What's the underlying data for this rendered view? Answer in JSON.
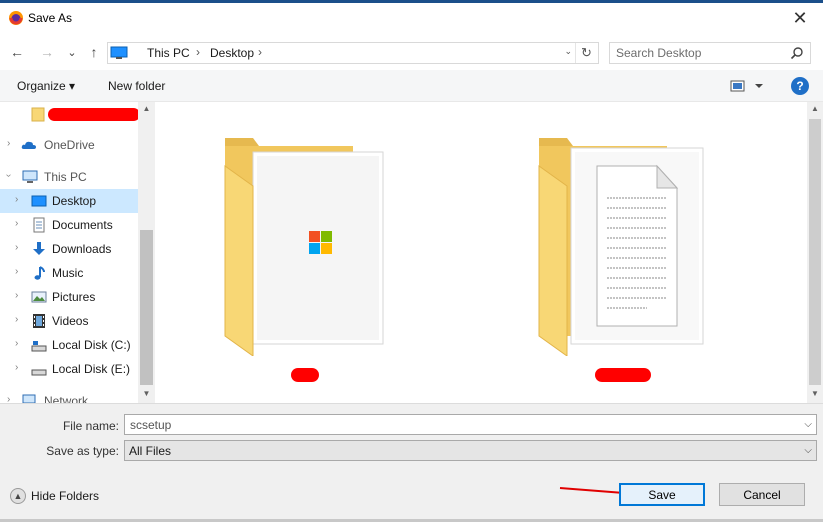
{
  "window": {
    "title": "Save As",
    "close_glyph": "✕",
    "app_icon": "firefox-icon"
  },
  "navigation": {
    "back_glyph": "←",
    "forward_glyph": "→",
    "recent_glyph": "⌄",
    "up_glyph": "↑",
    "breadcrumbs": [
      "This PC",
      "Desktop"
    ],
    "breadcrumb_sep": "›",
    "dropdown_glyph": "⌄",
    "refresh_glyph": "↻"
  },
  "search": {
    "placeholder": "Search Desktop"
  },
  "toolbar": {
    "organize": "Organize ▾",
    "new_folder": "New folder",
    "help": "?"
  },
  "sidebar": {
    "items": [
      {
        "label": "",
        "icon": "folder-icon",
        "redacted": true
      },
      {
        "label": "OneDrive",
        "icon": "onedrive-icon"
      },
      {
        "label": "This PC",
        "icon": "this-pc-icon"
      },
      {
        "label": "Desktop",
        "icon": "desktop-icon",
        "selected": true
      },
      {
        "label": "Documents",
        "icon": "documents-icon"
      },
      {
        "label": "Downloads",
        "icon": "downloads-icon"
      },
      {
        "label": "Music",
        "icon": "music-icon"
      },
      {
        "label": "Pictures",
        "icon": "pictures-icon"
      },
      {
        "label": "Videos",
        "icon": "videos-icon"
      },
      {
        "label": "Local Disk (C:)",
        "icon": "local-disk-icon"
      },
      {
        "label": "Local Disk (E:)",
        "icon": "local-disk-icon"
      },
      {
        "label": "Network",
        "icon": "network-icon"
      }
    ]
  },
  "files": [
    {
      "name": "",
      "type": "folder",
      "preview": "windows-logo",
      "redacted": true
    },
    {
      "name": "",
      "type": "folder",
      "preview": "document",
      "redacted": true
    }
  ],
  "form": {
    "file_name_label": "File name:",
    "file_name_value": "scsetup",
    "save_type_label": "Save as type:",
    "save_type_value": "All Files"
  },
  "footer": {
    "hide_folders": "Hide Folders",
    "save": "Save",
    "cancel": "Cancel"
  },
  "colors": {
    "accent": "#0078d7",
    "selection": "#cce8ff",
    "redaction": "#ff0000",
    "folder": "#f8d775"
  }
}
